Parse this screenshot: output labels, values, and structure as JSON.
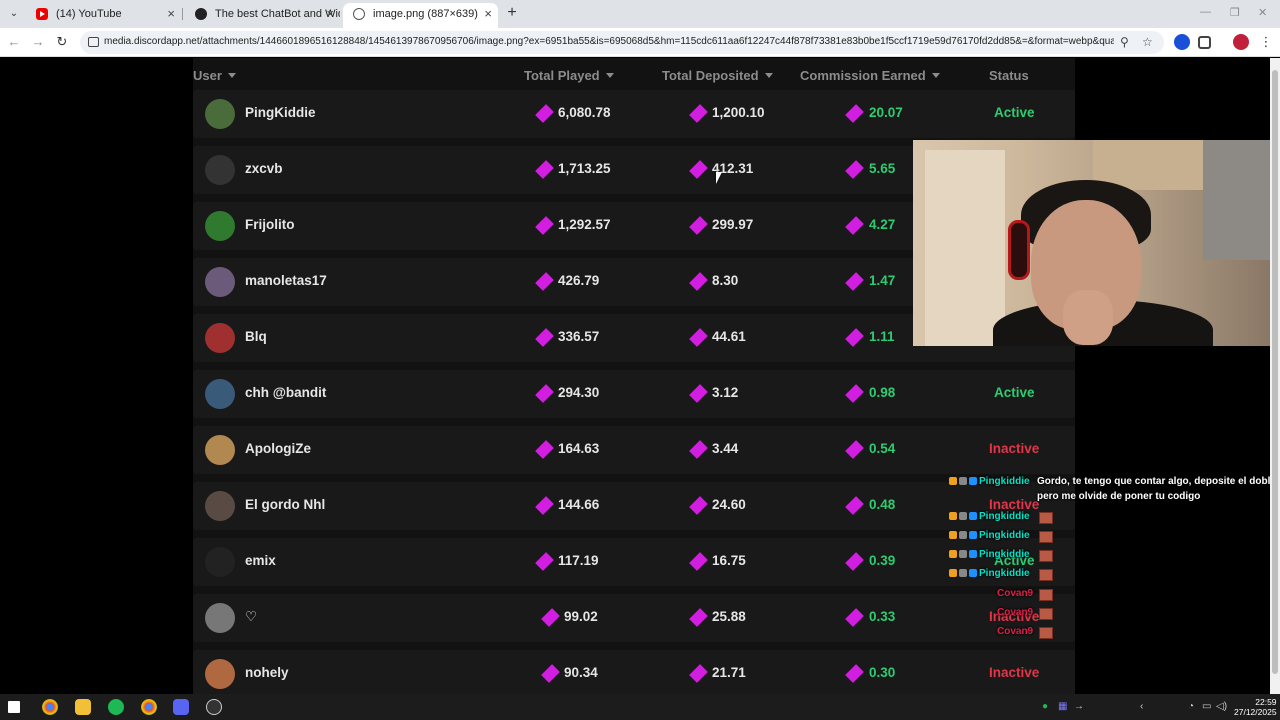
{
  "browser": {
    "tabs": [
      {
        "title": "(14) YouTube"
      },
      {
        "title": "The best ChatBot and Widgets"
      },
      {
        "title": "image.png (887×639)"
      }
    ],
    "url": "media.discordapp.net/attachments/1446601896516128848/1454613978670956706/image.png?ex=6951ba55&is=695068d5&hm=115cdc611aa6f12247c44f878f73381e83b0be1f5ccf1719e59d76170fd2dd85&=&format=webp&quality=lossless"
  },
  "table": {
    "headers": {
      "user": "User",
      "played": "Total Played",
      "deposited": "Total Deposited",
      "commission": "Commission Earned",
      "status": "Status"
    },
    "rows": [
      {
        "user": "PingKiddie",
        "played": "6,080.78",
        "deposited": "1,200.10",
        "commission": "20.07",
        "status": "Active"
      },
      {
        "user": "zxcvb",
        "played": "1,713.25",
        "deposited": "412.31",
        "commission": "5.65",
        "status": ""
      },
      {
        "user": "Frijolito",
        "played": "1,292.57",
        "deposited": "299.97",
        "commission": "4.27",
        "status": ""
      },
      {
        "user": "manoletas17",
        "played": "426.79",
        "deposited": "8.30",
        "commission": "1.47",
        "status": ""
      },
      {
        "user": "Blq",
        "played": "336.57",
        "deposited": "44.61",
        "commission": "1.11",
        "status": ""
      },
      {
        "user": "chh @bandit",
        "played": "294.30",
        "deposited": "3.12",
        "commission": "0.98",
        "status": "Active"
      },
      {
        "user": "ApologiZe",
        "played": "164.63",
        "deposited": "3.44",
        "commission": "0.54",
        "status": "Inactive"
      },
      {
        "user": "El gordo Nhl",
        "played": "144.66",
        "deposited": "24.60",
        "commission": "0.48",
        "status": "Inactive"
      },
      {
        "user": "emix",
        "played": "117.19",
        "deposited": "16.75",
        "commission": "0.39",
        "status": "Active"
      },
      {
        "user": "♡",
        "played": "99.02",
        "deposited": "25.88",
        "commission": "0.33",
        "status": "Inactive"
      },
      {
        "user": "nohely",
        "played": "90.34",
        "deposited": "21.71",
        "commission": "0.30",
        "status": "Inactive"
      }
    ]
  },
  "chat": {
    "messages": [
      {
        "nick": "Pingkiddie",
        "text": "Gordo, te tengo que contar algo, deposite el doble",
        "text2": "pero me olvide de poner tu codigo"
      },
      {
        "nick": "Pingkiddie"
      },
      {
        "nick": "Pingkiddie"
      },
      {
        "nick": "Pingkiddie"
      },
      {
        "nick": "Pingkiddie"
      },
      {
        "nick": "Covan9"
      },
      {
        "nick": "Covan9"
      },
      {
        "nick": "Covan9"
      }
    ]
  },
  "taskbar": {
    "time": "22:59",
    "date": "27/12/2025"
  },
  "colors": {
    "active": "#2ecc71",
    "inactive": "#e0354a",
    "gem": "#d21ee0"
  }
}
